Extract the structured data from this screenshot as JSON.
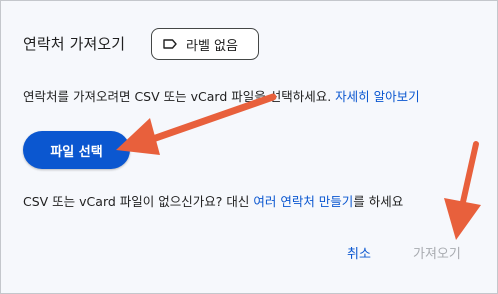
{
  "dialog": {
    "title": "연락처 가져오기",
    "label_chip": {
      "icon": "label-outline-icon",
      "text": "라벨 없음"
    },
    "instruction": {
      "text": "연락처를 가져오려면 CSV 또는 vCard 파일을 선택하세요. ",
      "learn_more": "자세히 알아보기"
    },
    "select_file_button": "파일 선택",
    "alternative": {
      "text_before": "CSV 또는 vCard 파일이 없으신가요? 대신 ",
      "link": "여러 연락처 만들기",
      "text_after": "를 하세요"
    },
    "buttons": {
      "cancel": "취소",
      "import": "가져오기"
    }
  },
  "colors": {
    "accent": "#0b57d0",
    "annotation_arrow": "#e8603c",
    "disabled_text": "#a8abb0",
    "background": "#f6f8fc"
  }
}
